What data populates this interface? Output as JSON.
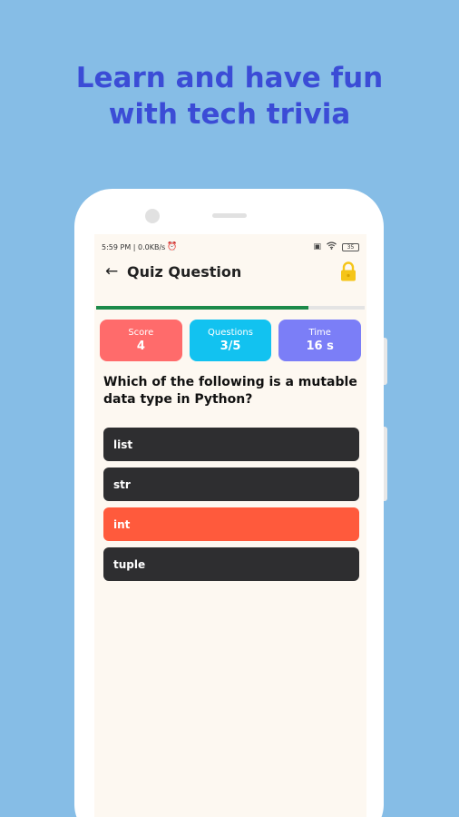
{
  "headline": {
    "line1": "Learn and have fun",
    "line2": "with tech trivia"
  },
  "status": {
    "time_speed": "5:59 PM | 0.0KB/s",
    "battery": "35"
  },
  "appbar": {
    "back_icon": "arrow-left-icon",
    "title": "Quiz Question",
    "lock_icon": "lock-icon"
  },
  "progress": {
    "fraction": 0.79,
    "color": "#1c8a4a"
  },
  "stats": [
    {
      "label": "Score",
      "value": "4",
      "color": "#ff6b6b"
    },
    {
      "label": "Questions",
      "value": "3/5",
      "color": "#12c2f0"
    },
    {
      "label": "Time",
      "value": "16 s",
      "color": "#7b7ef7"
    }
  ],
  "question": "Which of the following is a mutable data type in Python?",
  "options": [
    {
      "label": "list",
      "state": "default"
    },
    {
      "label": "str",
      "state": "default"
    },
    {
      "label": "int",
      "state": "wrong"
    },
    {
      "label": "tuple",
      "state": "default"
    }
  ],
  "colors": {
    "background": "#86bde6",
    "headline": "#3b4cd6",
    "option_default": "#2e2e30",
    "option_wrong": "#ff5a3c",
    "lock": "#f5c518"
  }
}
